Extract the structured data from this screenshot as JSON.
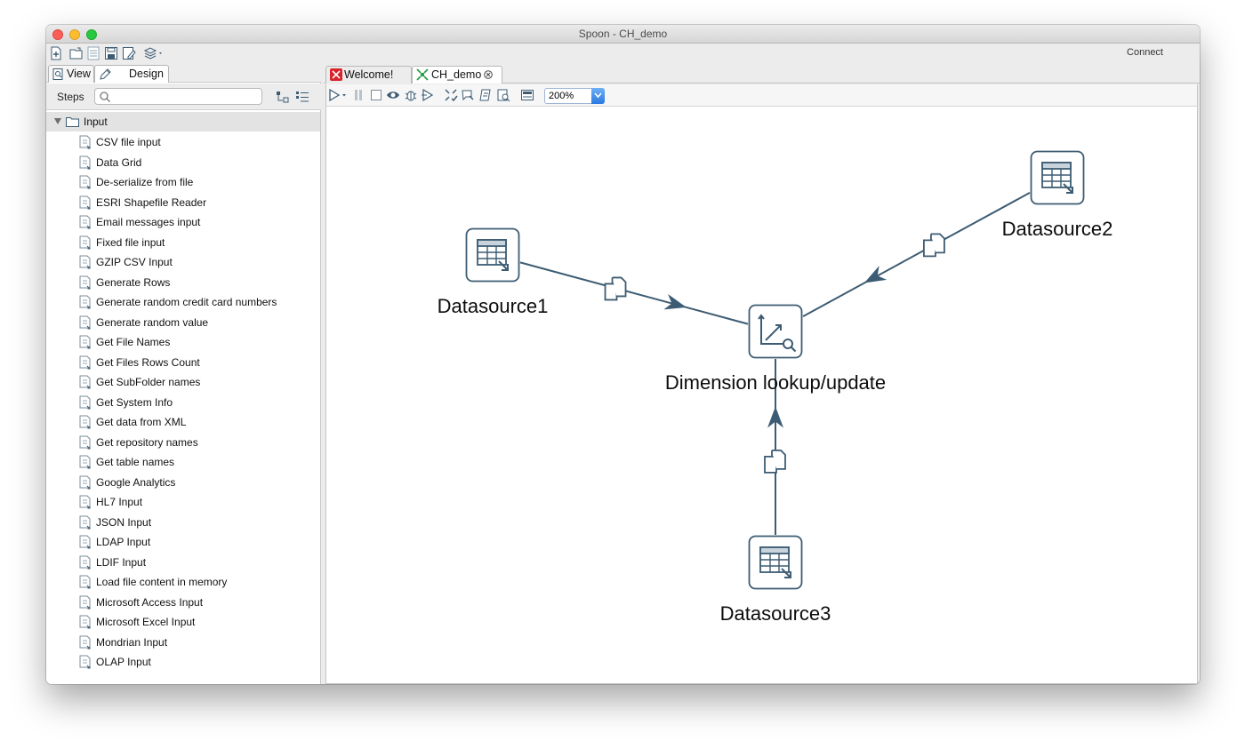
{
  "window": {
    "title": "Spoon - CH_demo"
  },
  "toolbar": {
    "connect_label": "Connect"
  },
  "left_panel": {
    "tabs": [
      {
        "label": "View"
      },
      {
        "label": "Design"
      }
    ],
    "steps_label": "Steps",
    "search_placeholder": "",
    "category": {
      "label": "Input"
    },
    "items": [
      {
        "label": "CSV file input"
      },
      {
        "label": "Data Grid"
      },
      {
        "label": "De-serialize from file"
      },
      {
        "label": "ESRI Shapefile Reader"
      },
      {
        "label": "Email messages input"
      },
      {
        "label": "Fixed file input"
      },
      {
        "label": "GZIP CSV Input"
      },
      {
        "label": "Generate Rows"
      },
      {
        "label": "Generate random credit card numbers"
      },
      {
        "label": "Generate random value"
      },
      {
        "label": "Get File Names"
      },
      {
        "label": "Get Files Rows Count"
      },
      {
        "label": "Get SubFolder names"
      },
      {
        "label": "Get System Info"
      },
      {
        "label": "Get data from XML"
      },
      {
        "label": "Get repository names"
      },
      {
        "label": "Get table names"
      },
      {
        "label": "Google Analytics"
      },
      {
        "label": "HL7 Input"
      },
      {
        "label": "JSON Input"
      },
      {
        "label": "LDAP Input"
      },
      {
        "label": "LDIF Input"
      },
      {
        "label": "Load file content in memory"
      },
      {
        "label": "Microsoft Access Input"
      },
      {
        "label": "Microsoft Excel Input"
      },
      {
        "label": "Mondrian Input"
      },
      {
        "label": "OLAP Input"
      }
    ]
  },
  "editor": {
    "tabs": [
      {
        "label": "Welcome!"
      },
      {
        "label": "CH_demo"
      }
    ],
    "zoom": "200%",
    "nodes": [
      {
        "id": "ds1",
        "label": "Datasource1",
        "icon": "table-input-icon"
      },
      {
        "id": "ds2",
        "label": "Datasource2",
        "icon": "table-input-icon"
      },
      {
        "id": "ds3",
        "label": "Datasource3",
        "icon": "table-input-icon"
      },
      {
        "id": "dim",
        "label": "Dimension lookup/update",
        "icon": "dimension-lookup-icon"
      }
    ],
    "hops": [
      {
        "from": "ds1",
        "to": "dim"
      },
      {
        "from": "ds2",
        "to": "dim"
      },
      {
        "from": "ds3",
        "to": "dim"
      }
    ]
  },
  "colors": {
    "hop": "#3d5c73",
    "node_border": "#3d5c73",
    "zoom_button": "#2a79e0"
  }
}
